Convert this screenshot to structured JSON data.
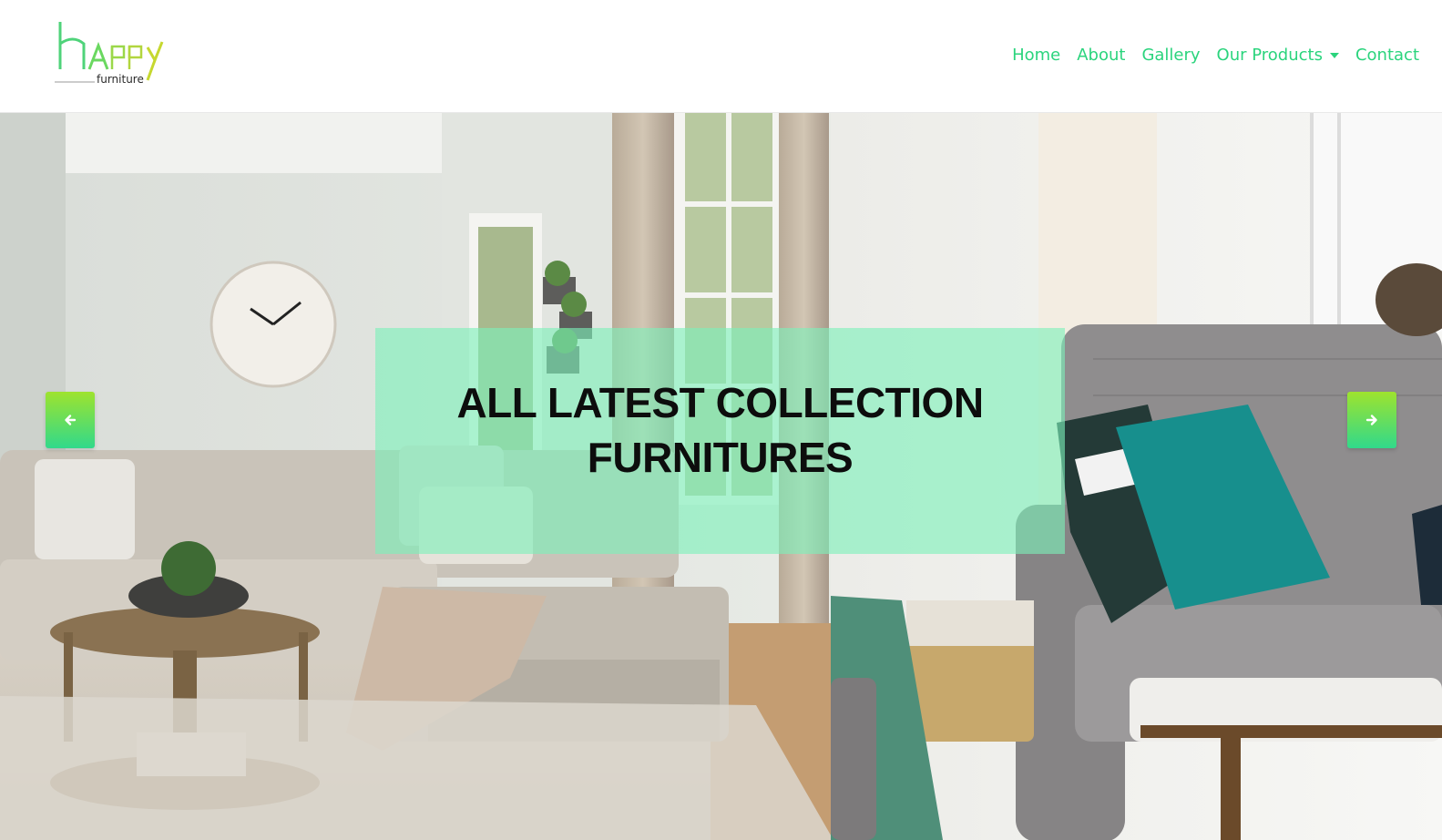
{
  "brand": {
    "logo_word": "hAPPy",
    "logo_subtext": "furniture",
    "colors": {
      "accent_green": "#2bd47d",
      "lime": "#a5d83a"
    }
  },
  "nav": {
    "items": [
      {
        "label": "Home"
      },
      {
        "label": "About"
      },
      {
        "label": "Gallery"
      },
      {
        "label": "Our Products"
      },
      {
        "label": "Contact"
      }
    ]
  },
  "hero": {
    "caption_line1": "ALL LATEST COLLECTION",
    "caption_line2": "FURNITURES",
    "prev_icon": "arrow-left-icon",
    "next_icon": "arrow-right-icon"
  }
}
